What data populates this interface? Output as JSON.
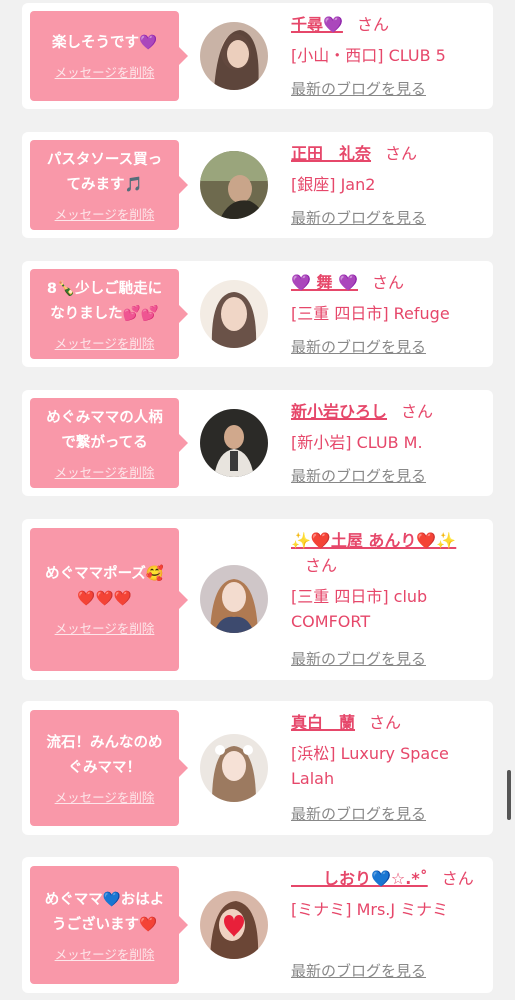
{
  "colors": {
    "bubble": "#f998a9",
    "accent": "#e6476a",
    "link_gray": "#888888",
    "background": "#f1f1f1"
  },
  "cards": [
    {
      "message": "楽しそうです💜",
      "delete_label": "メッセージを削除",
      "name": "千尋💜",
      "honorific": "さん",
      "shop": "[小山・西口] CLUB 5",
      "blog_label": "最新のブログを見る",
      "avatar_icon": "profile-photo-icon"
    },
    {
      "message": "パスタソース買ってみます🎵",
      "delete_label": "メッセージを削除",
      "name": "正田　礼奈",
      "honorific": "さん",
      "shop": "[銀座] Jan2",
      "blog_label": "最新のブログを見る",
      "avatar_icon": "profile-photo-icon"
    },
    {
      "message": "8🍾少しご馳走になりました💕💕",
      "delete_label": "メッセージを削除",
      "name": "💜 舞 💜",
      "honorific": "さん",
      "shop": "[三重 四日市] Refuge",
      "blog_label": "最新のブログを見る",
      "avatar_icon": "profile-photo-icon"
    },
    {
      "message": "めぐみママの人柄で繋がってる",
      "delete_label": "メッセージを削除",
      "name": "新小岩ひろし",
      "honorific": "さん",
      "shop": "[新小岩] CLUB M.",
      "blog_label": "最新のブログを見る",
      "avatar_icon": "profile-photo-icon"
    },
    {
      "message": "めぐママポーズ🥰\n❤️❤️❤️",
      "delete_label": "メッセージを削除",
      "name": "✨❤️土屋 あんり❤️✨",
      "honorific": "さん",
      "shop": "[三重 四日市] club COMFORT",
      "blog_label": "最新のブログを見る",
      "avatar_icon": "profile-photo-icon"
    },
    {
      "message": "流石！みんなのめぐみママ！",
      "delete_label": "メッセージを削除",
      "name": "真白　蘭",
      "honorific": "さん",
      "shop": "[浜松] Luxury Space Lalah",
      "blog_label": "最新のブログを見る",
      "avatar_icon": "profile-photo-icon"
    },
    {
      "message": "めぐママ💙おはようございます❤️",
      "delete_label": "メッセージを削除",
      "name": "　　しおり💙☆.*˚",
      "honorific": "さん",
      "shop": "[ミナミ] Mrs.J ミナミ",
      "blog_label": "最新のブログを見る",
      "avatar_icon": "profile-photo-icon"
    }
  ]
}
